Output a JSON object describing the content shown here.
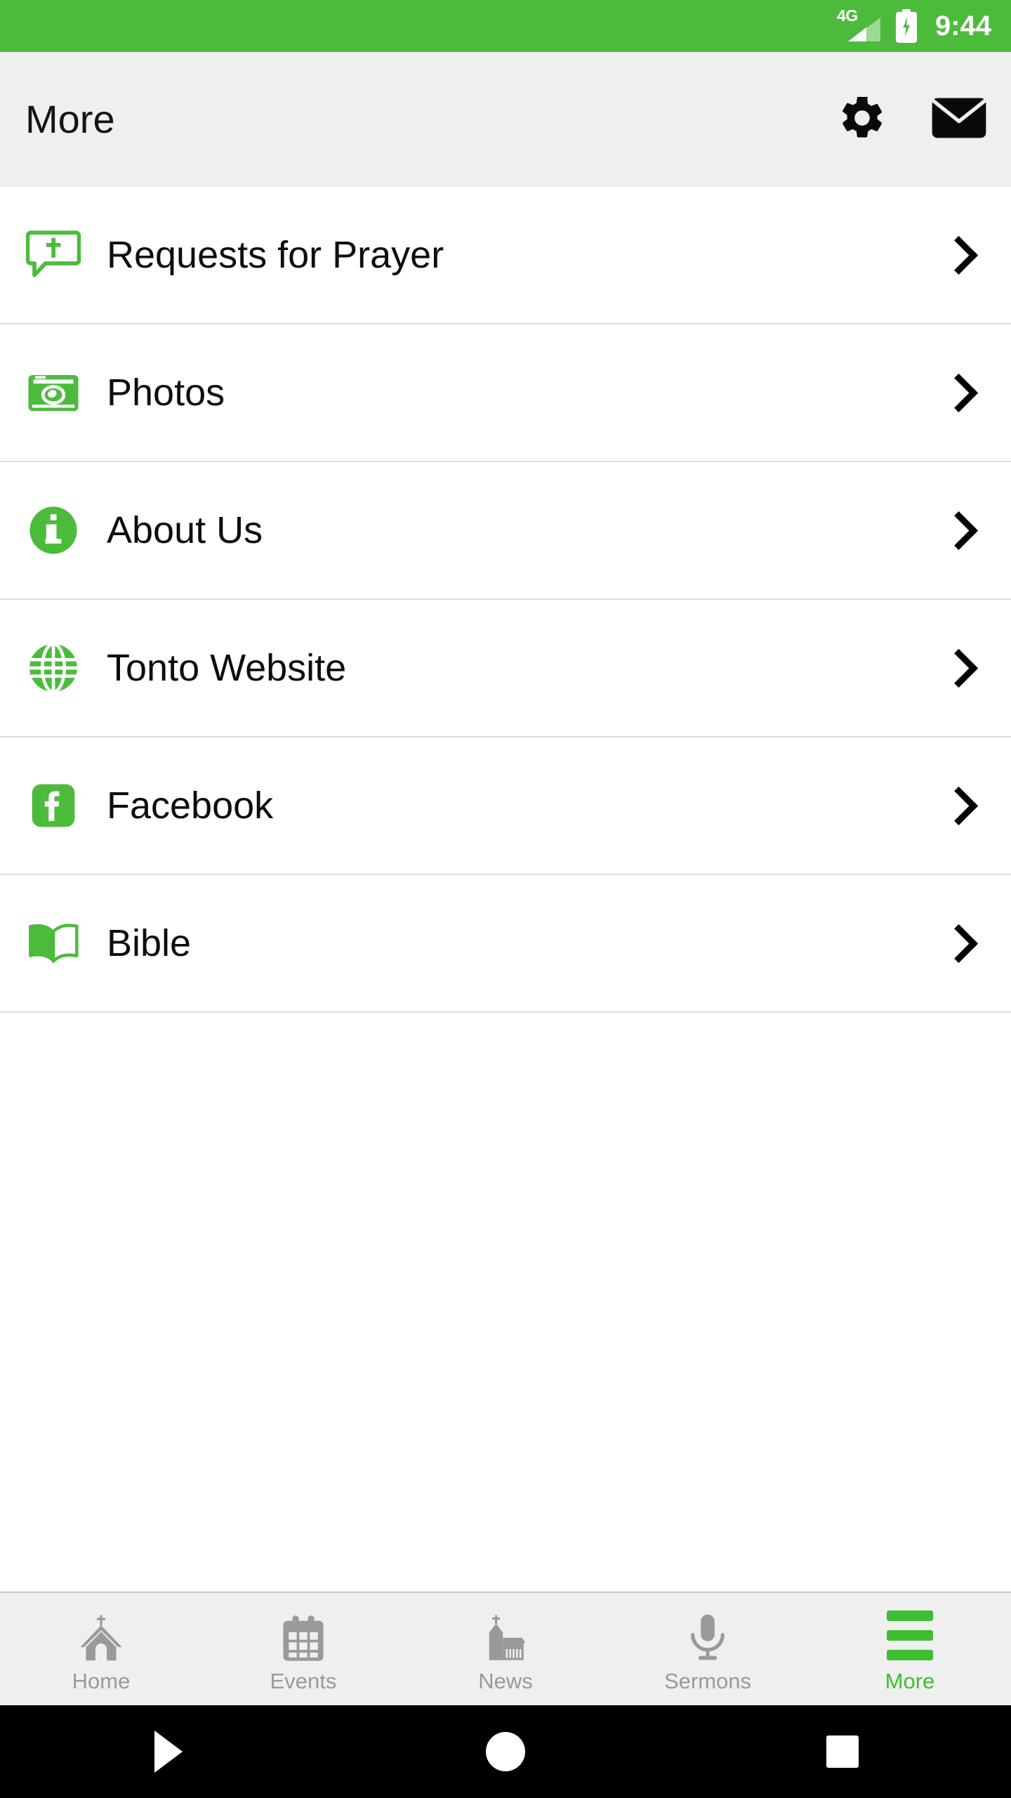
{
  "status_bar": {
    "network": "4G",
    "time": "9:44",
    "battery_state": "charging",
    "background_color": "#4CBB3C"
  },
  "header": {
    "title": "More",
    "background_color": "#EFEFEF",
    "actions": [
      {
        "name": "settings",
        "icon": "gear-icon"
      },
      {
        "name": "mail",
        "icon": "envelope-icon"
      }
    ]
  },
  "menu": {
    "accent_color": "#4CBB3C",
    "items": [
      {
        "label": "Requests for Prayer",
        "icon": "prayer-bubble-cross-icon",
        "chevron": "chevron-right-icon"
      },
      {
        "label": "Photos",
        "icon": "camera-icon",
        "chevron": "chevron-right-icon"
      },
      {
        "label": "About Us",
        "icon": "info-circle-icon",
        "chevron": "chevron-right-icon"
      },
      {
        "label": "Tonto Website",
        "icon": "globe-icon",
        "chevron": "chevron-right-icon"
      },
      {
        "label": "Facebook",
        "icon": "facebook-icon",
        "chevron": "chevron-right-icon"
      },
      {
        "label": "Bible",
        "icon": "open-book-icon",
        "chevron": "chevron-right-icon"
      }
    ]
  },
  "tab_bar": {
    "inactive_color": "#9A9A9A",
    "active_color": "#3FBD33",
    "tabs": [
      {
        "label": "Home",
        "icon": "church-steeple-icon",
        "active": false
      },
      {
        "label": "Events",
        "icon": "calendar-icon",
        "active": false
      },
      {
        "label": "News",
        "icon": "church-building-icon",
        "active": false
      },
      {
        "label": "Sermons",
        "icon": "microphone-icon",
        "active": false
      },
      {
        "label": "More",
        "icon": "hamburger-menu-icon",
        "active": true
      }
    ]
  },
  "system_nav": {
    "buttons": [
      {
        "name": "back",
        "icon": "triangle-back-icon"
      },
      {
        "name": "home",
        "icon": "circle-home-icon"
      },
      {
        "name": "recents",
        "icon": "square-recents-icon"
      }
    ]
  }
}
